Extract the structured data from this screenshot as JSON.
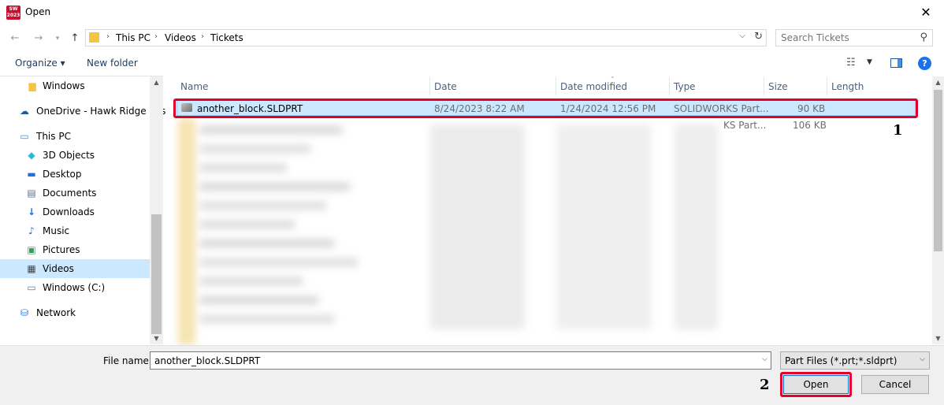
{
  "window": {
    "title": "Open",
    "app_icon_text": "SW 2023",
    "close_glyph": "✕"
  },
  "address": {
    "path": [
      "This PC",
      "Videos",
      "Tickets"
    ]
  },
  "search": {
    "placeholder": "Search Tickets"
  },
  "toolbar": {
    "organize": "Organize ▾",
    "new_folder": "New folder",
    "help": "?"
  },
  "nav": {
    "items": [
      {
        "label": "Windows",
        "icon": "folder-icon",
        "color": "#f5c542",
        "glyph": "▆"
      },
      {
        "label": "OneDrive - Hawk Ridge Sys",
        "icon": "onedrive-icon",
        "color": "#1e5aa8",
        "glyph": "☁"
      },
      {
        "label": "This PC",
        "icon": "computer-icon",
        "color": "#3a8ee6",
        "glyph": "▭"
      },
      {
        "label": "3D Objects",
        "icon": "cube-icon",
        "color": "#2ab7d8",
        "glyph": "◆"
      },
      {
        "label": "Desktop",
        "icon": "desktop-icon",
        "color": "#1e6fd9",
        "glyph": "▬"
      },
      {
        "label": "Documents",
        "icon": "documents-icon",
        "color": "#5a6f8f",
        "glyph": "▤"
      },
      {
        "label": "Downloads",
        "icon": "downloads-icon",
        "color": "#1e6fd9",
        "glyph": "↓"
      },
      {
        "label": "Music",
        "icon": "music-icon",
        "color": "#1e6fd9",
        "glyph": "♪"
      },
      {
        "label": "Pictures",
        "icon": "pictures-icon",
        "color": "#3c9a5f",
        "glyph": "▣"
      },
      {
        "label": "Videos",
        "icon": "videos-icon",
        "color": "#444444",
        "glyph": "▦"
      },
      {
        "label": "Windows (C:)",
        "icon": "drive-icon",
        "color": "#6b7a8f",
        "glyph": "▭"
      },
      {
        "label": "Network",
        "icon": "network-icon",
        "color": "#1e6fd9",
        "glyph": "⛁"
      }
    ],
    "selected": "Videos"
  },
  "columns": [
    "Name",
    "Date",
    "Date modified",
    "Type",
    "Size",
    "Length"
  ],
  "files": [
    {
      "name": "another_block.SLDPRT",
      "date": "8/24/2023 8:22 AM",
      "date_modified": "1/24/2024 12:56 PM",
      "type": "SOLIDWORKS Part...",
      "size": "90 KB"
    },
    {
      "type": "KS Part...",
      "size": "106 KB"
    }
  ],
  "footer": {
    "file_name_label": "File name:",
    "file_name_value": "another_block.SLDPRT",
    "file_type": "Part Files (*.prt;*.sldprt)",
    "open": "Open",
    "cancel": "Cancel"
  },
  "annotations": [
    "1",
    "2"
  ],
  "colors": {
    "selection": "#cce8ff",
    "annotation": "#e4002b",
    "accent": "#0078d7"
  }
}
